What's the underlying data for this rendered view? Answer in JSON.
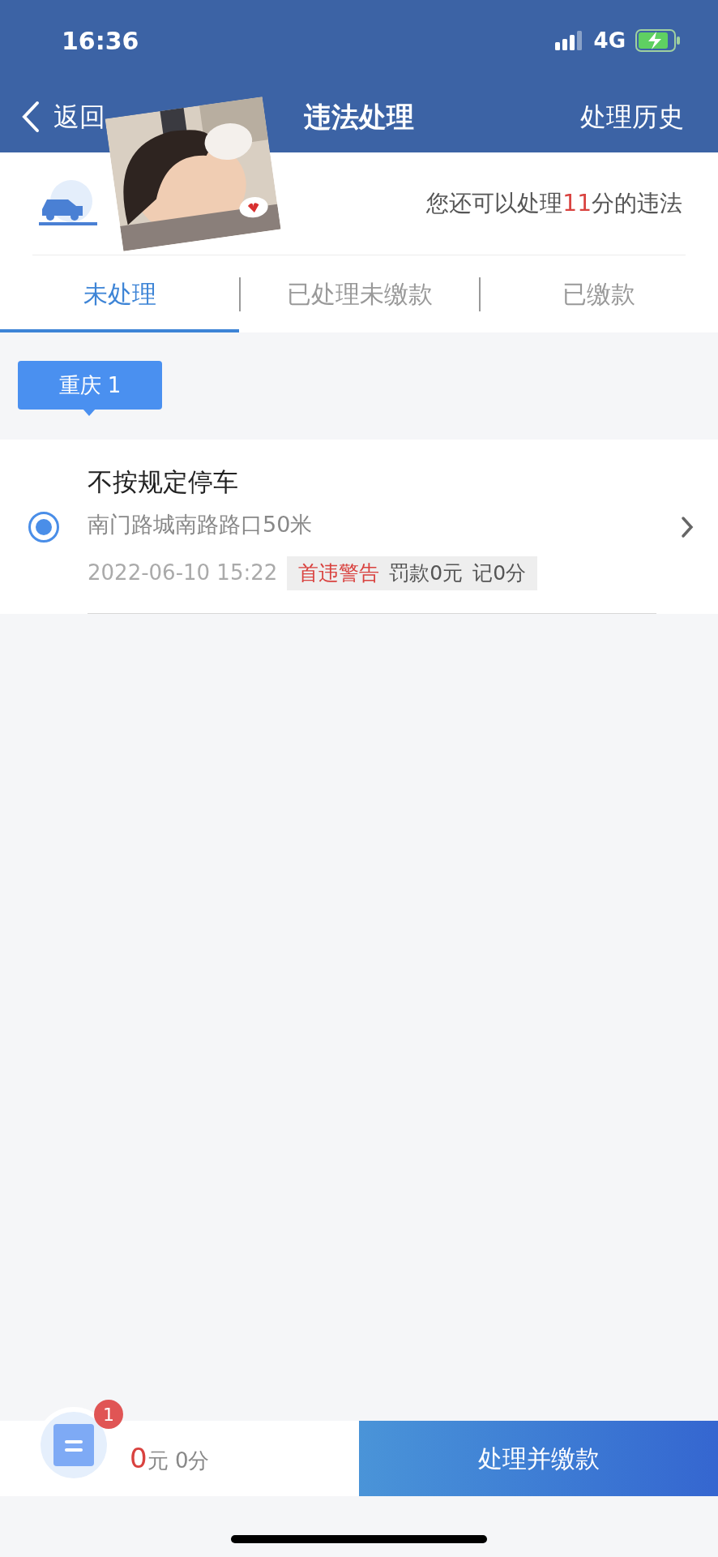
{
  "status_bar": {
    "time": "16:36",
    "network": "4G"
  },
  "nav": {
    "back": "返回",
    "title": "违法处理",
    "action": "处理历史"
  },
  "summary": {
    "prefix": "您还可以处理",
    "points": "11",
    "suffix": "分的违法"
  },
  "tabs": [
    {
      "label": "未处理",
      "selected": true
    },
    {
      "label": "已处理未缴款",
      "selected": false
    },
    {
      "label": "已缴款",
      "selected": false
    }
  ],
  "region_tag": "重庆 1",
  "violations": [
    {
      "selected": true,
      "title": "不按规定停车",
      "location": "南门路城南路路口50米",
      "time": "2022-06-10 15:22",
      "warning": "首违警告",
      "fine": "罚款0元",
      "points": "记0分"
    }
  ],
  "footer": {
    "badge": "1",
    "amount": "0",
    "unit": "元",
    "points": "0分",
    "button": "处理并缴款"
  }
}
